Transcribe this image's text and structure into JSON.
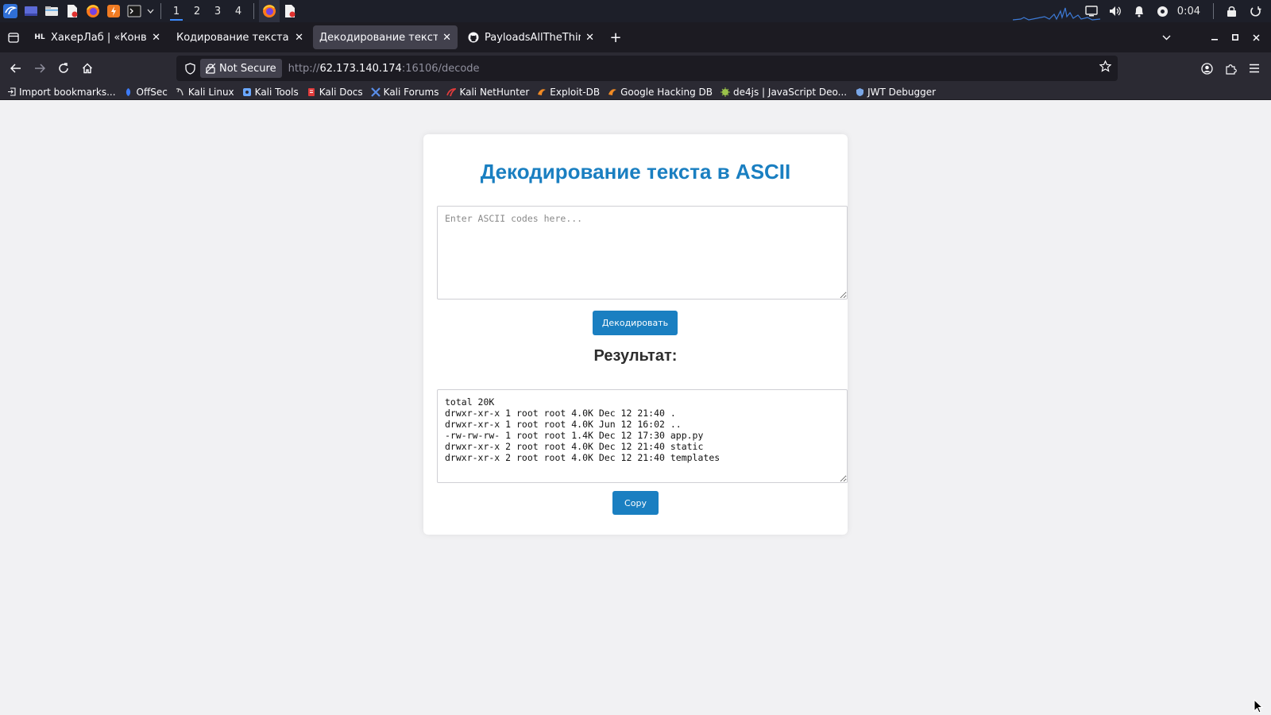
{
  "os_panel": {
    "workspaces": [
      "1",
      "2",
      "3",
      "4"
    ],
    "clock": "0:04"
  },
  "tabs": [
    {
      "title": "ХакерЛаб | «Конвертер»",
      "favicon_text": "HL",
      "active": false
    },
    {
      "title": "Кодирование текста в ASCII",
      "active": false
    },
    {
      "title": "Декодирование текста из ASCII",
      "active": true
    },
    {
      "title": "PayloadsAllTheThings/Se",
      "active": false
    }
  ],
  "navbar": {
    "not_secure_label": "Not Secure",
    "url_scheme": "http://",
    "url_host": "62.173.140.174",
    "url_rest": ":16106/decode"
  },
  "bookmarks": [
    {
      "label": "Import bookmarks...",
      "icon": "import-icon",
      "color": "#fbfbfe"
    },
    {
      "label": "OffSec",
      "icon": "offsec-icon",
      "color": "#3d7bf7"
    },
    {
      "label": "Kali Linux",
      "icon": "kali-dragon-icon",
      "color": "#d0d0d0"
    },
    {
      "label": "Kali Tools",
      "icon": "kali-tools-icon",
      "color": "#6aa7ff"
    },
    {
      "label": "Kali Docs",
      "icon": "kali-docs-icon",
      "color": "#e03b3b"
    },
    {
      "label": "Kali Forums",
      "icon": "kali-forums-icon",
      "color": "#5a8de8"
    },
    {
      "label": "Kali NetHunter",
      "icon": "nethunter-icon",
      "color": "#e03b3b"
    },
    {
      "label": "Exploit-DB",
      "icon": "exploitdb-icon",
      "color": "#f08a24"
    },
    {
      "label": "Google Hacking DB",
      "icon": "ghdb-icon",
      "color": "#f08a24"
    },
    {
      "label": "de4js | JavaScript Deo...",
      "icon": "de4js-icon",
      "color": "#9ac24a"
    },
    {
      "label": "JWT Debugger",
      "icon": "jwt-icon",
      "color": "#7aa7e8"
    }
  ],
  "page": {
    "heading": "Декодирование текста в ASCII",
    "input_placeholder": "Enter ASCII codes here...",
    "decode_button": "Декодировать",
    "result_label": "Результат:",
    "output_text": "total 20K\ndrwxr-xr-x 1 root root 4.0K Dec 12 21:40 .\ndrwxr-xr-x 1 root root 4.0K Jun 12 16:02 ..\n-rw-rw-rw- 1 root root 1.4K Dec 12 17:30 app.py\ndrwxr-xr-x 2 root root 4.0K Dec 12 21:40 static\ndrwxr-xr-x 2 root root 4.0K Dec 12 21:40 templates",
    "copy_button": "Copy"
  },
  "colors": {
    "accent": "#1a7fc1",
    "page_bg": "#f1f1f3",
    "tabbar_bg": "#1c1b22",
    "navbar_bg": "#2b2a33"
  }
}
